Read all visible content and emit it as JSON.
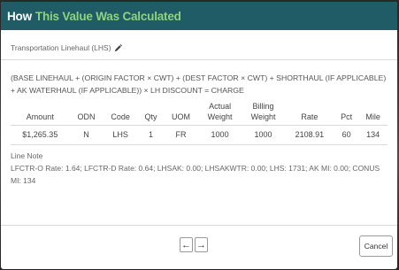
{
  "dialog": {
    "title_part1": "How",
    "title_part2": "This Value Was Calculated"
  },
  "section": {
    "label": "Transportation Linehaul (LHS)"
  },
  "formula": "(BASE LINEHAUL + (ORIGIN FACTOR × CWT) + (DEST FACTOR × CWT) + SHORTHAUL (IF APPLICABLE) + AK WATERHAUL (IF APPLICABLE)) × LH DISCOUNT = CHARGE",
  "table": {
    "columns": {
      "amount": "Amount",
      "odn": "ODN",
      "code": "Code",
      "qty": "Qty",
      "uom": "UOM",
      "actual_weight_1": "Actual",
      "actual_weight_2": "Weight",
      "billing_weight_1": "Billing",
      "billing_weight_2": "Weight",
      "rate": "Rate",
      "pct": "Pct",
      "mile": "Mile"
    },
    "rows": [
      {
        "amount": "$1,265.35",
        "odn": "N",
        "code": "LHS",
        "qty": "1",
        "uom": "FR",
        "actual_weight": "1000",
        "billing_weight": "1000",
        "rate": "2108.91",
        "pct": "60",
        "mile": "134"
      }
    ]
  },
  "line_note": {
    "label": "Line Note",
    "text": "LFCTR-O Rate: 1.64; LFCTR-D Rate: 0.64; LHSAK: 0.00; LHSAKWTR: 0.00; LHS: 1731; AK MI: 0.00; CONUS MI: 134"
  },
  "footer": {
    "prev_symbol": "←",
    "next_symbol": "→",
    "cancel_label": "Cancel"
  },
  "colors": {
    "header_bg": "#1f5c66",
    "title_accent": "#8fd37f"
  }
}
